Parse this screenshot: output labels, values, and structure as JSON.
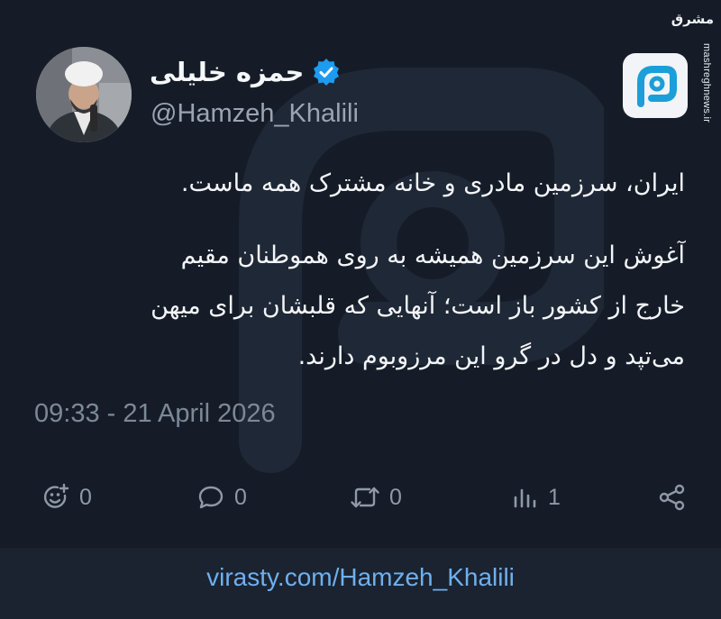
{
  "watermark": {
    "logo_text": "مشرق",
    "site": "mashreghnews.ir"
  },
  "profile": {
    "display_name": "حمزه خلیلی",
    "handle": "@Hamzeh_Khalili",
    "verified": true,
    "accent_color": "#1d9bf0"
  },
  "tweet": {
    "paragraphs": [
      [
        "ایران، سرزمین مادری و خانه مشترک همه ماست."
      ],
      [
        "آغوش این سرزمین همیشه به روی هموطنان مقیم",
        "خارج از کشور باز است؛ آنهایی که قلبشان برای میهن",
        "می‌تپد و دل در گرو این مرزوبوم دارند."
      ]
    ],
    "timestamp": "09:33 - 21 April 2026"
  },
  "actions": {
    "reactions": {
      "icon": "emoji-add-icon",
      "count": "0"
    },
    "replies": {
      "icon": "reply-icon",
      "count": "0"
    },
    "reposts": {
      "icon": "repost-icon",
      "count": "0"
    },
    "views": {
      "icon": "analytics-icon",
      "count": "1"
    },
    "share": {
      "icon": "share-icon"
    }
  },
  "footer": {
    "url": "virasty.com/Hamzeh_Khalili"
  },
  "colors": {
    "page_background": "#1b2330",
    "card_background": "#151c28",
    "text_primary": "#f3f5f8",
    "text_muted": "#8f99a6",
    "link": "#6fb0ee"
  }
}
